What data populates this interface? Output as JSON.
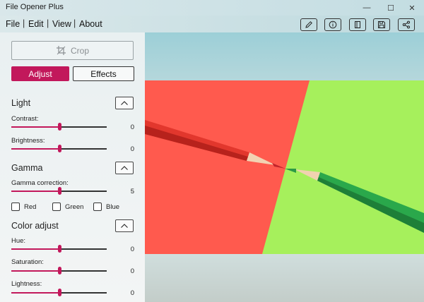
{
  "app": {
    "title": "File Opener Plus"
  },
  "window_controls": {
    "minimize": "—",
    "maximize": "☐",
    "close": "✕"
  },
  "menu": {
    "items": [
      "File",
      "Edit",
      "View",
      "About"
    ],
    "separator": "|"
  },
  "toolbar": {
    "icons": [
      "pencil-icon",
      "info-icon",
      "book-icon",
      "save-icon",
      "share-icon"
    ]
  },
  "sidebar": {
    "crop_label": "Crop",
    "tabs": {
      "adjust": "Adjust",
      "effects": "Effects"
    },
    "light": {
      "title": "Light",
      "contrast": {
        "label": "Contrast:",
        "value": "0",
        "fraction": 0.5
      },
      "brightness": {
        "label": "Brightness:",
        "value": "0",
        "fraction": 0.5
      }
    },
    "gamma": {
      "title": "Gamma",
      "correction": {
        "label": "Gamma correction:",
        "value": "5",
        "fraction": 0.5
      },
      "channels": [
        {
          "label": "Red",
          "checked": false
        },
        {
          "label": "Green",
          "checked": false
        },
        {
          "label": "Blue",
          "checked": false
        }
      ]
    },
    "color": {
      "title": "Color adjust",
      "hue": {
        "label": "Hue:",
        "value": "0",
        "fraction": 0.5
      },
      "saturation": {
        "label": "Saturation:",
        "value": "0",
        "fraction": 0.5
      },
      "lightness": {
        "label": "Lightness:",
        "value": "0",
        "fraction": 0.5
      }
    }
  },
  "colors": {
    "accent": "#c2185b",
    "red_paper": "#ff5a4e",
    "green_paper": "#a6f05c"
  }
}
